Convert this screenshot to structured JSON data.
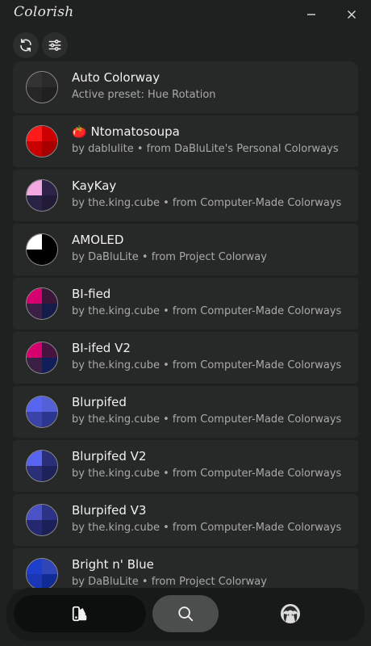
{
  "app": {
    "title": "Colorish"
  },
  "colorways": [
    {
      "title": "Auto Colorway",
      "subtitle": "Active preset: Hue Rotation",
      "colors": [
        "#333333",
        "#2a2a2a",
        "#262626",
        "#202020"
      ]
    },
    {
      "title": "🍅 Ntomatosoupa",
      "subtitle": "by dablulite • from DaBluLite's Personal Colorways",
      "colors": [
        "#ff1a1a",
        "#cc0000",
        "#c90000",
        "#a80000"
      ]
    },
    {
      "title": "KayKay",
      "subtitle": "by the.king.cube • from Computer-Made Colorways",
      "colors": [
        "#f4a8e0",
        "#2d2248",
        "#2a2345",
        "#221b38"
      ]
    },
    {
      "title": "AMOLED",
      "subtitle": "by DaBluLite • from Project Colorway",
      "colors": [
        "#ffffff",
        "#000000",
        "#000000",
        "#000000"
      ]
    },
    {
      "title": "BI-fied",
      "subtitle": "by the.king.cube • from Computer-Made Colorways",
      "colors": [
        "#d6006e",
        "#3a1638",
        "#3c1f44",
        "#161c4a"
      ]
    },
    {
      "title": "BI-ifed V2",
      "subtitle": "by the.king.cube • from Computer-Made Colorways",
      "colors": [
        "#d6006e",
        "#46143e",
        "#3c1f44",
        "#101e5a"
      ]
    },
    {
      "title": "Blurpifed",
      "subtitle": "by the.king.cube • from Computer-Made Colorways",
      "colors": [
        "#5865f2",
        "#5460d8",
        "#3a44a8",
        "#2c3590"
      ]
    },
    {
      "title": "Blurpifed V2",
      "subtitle": "by the.king.cube • from Computer-Made Colorways",
      "colors": [
        "#5865f2",
        "#2a2f78",
        "#2a2f78",
        "#1e225a"
      ]
    },
    {
      "title": "Blurpifed V3",
      "subtitle": "by the.king.cube • from Computer-Made Colorways",
      "colors": [
        "#4a52c8",
        "#2c3286",
        "#232870",
        "#1c2058"
      ]
    },
    {
      "title": "Bright n' Blue",
      "subtitle": "by DaBluLite • from Project Colorway",
      "colors": [
        "#1e3ecc",
        "#3046b8",
        "#1a36b4",
        "#102a96"
      ]
    }
  ],
  "nav": {
    "tabs": [
      {
        "name": "colorways",
        "icon": "palette-icon",
        "selected": true
      },
      {
        "name": "search",
        "icon": "search-icon",
        "selected": false
      },
      {
        "name": "profile",
        "icon": "avatar-icon",
        "selected": false
      }
    ]
  },
  "icons": {
    "refresh": "refresh-icon",
    "filter": "sliders-icon",
    "minimize": "minimize-icon",
    "close": "close-icon"
  }
}
